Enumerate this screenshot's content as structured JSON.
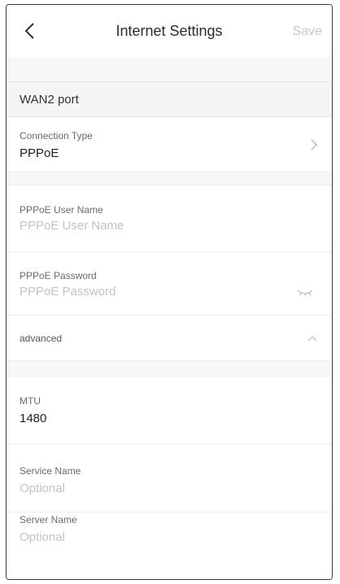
{
  "header": {
    "title": "Internet Settings",
    "save_label": "Save",
    "back_icon": "chevron-left-icon"
  },
  "wan_section": {
    "label": "WAN2 port"
  },
  "connection_type": {
    "label": "Connection Type",
    "value": "PPPoE",
    "icon": "chevron-right-icon"
  },
  "pppoe_user": {
    "label": "PPPoE User Name",
    "placeholder": "PPPoE User Name"
  },
  "pppoe_password": {
    "label": "PPPoE Password",
    "placeholder": "PPPoE Password",
    "icon": "eye-closed-icon"
  },
  "advanced": {
    "label": "advanced",
    "icon": "chevron-up-icon"
  },
  "mtu": {
    "label": "MTU",
    "value": "1480"
  },
  "service_name": {
    "label": "Service Name",
    "placeholder": "Optional"
  },
  "server_name": {
    "label": "Server Name",
    "placeholder": "Optional"
  },
  "colors": {
    "text": "#1f1f1f",
    "muted": "#6a6a6a",
    "placeholder": "#c3c3c3",
    "disabled": "#c9c9c9",
    "section_bg": "#f5f5f7"
  }
}
